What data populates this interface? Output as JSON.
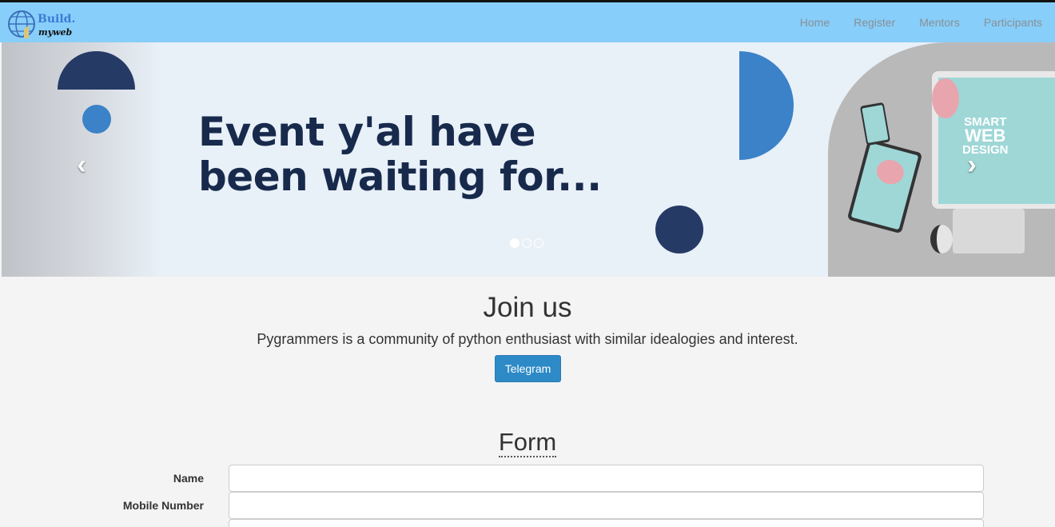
{
  "navbar": {
    "logo_line1": "Build.",
    "logo_line2": "myweb",
    "links": [
      {
        "label": "Home"
      },
      {
        "label": "Register"
      },
      {
        "label": "Mentors"
      },
      {
        "label": "Participants"
      }
    ],
    "bg_color": "#87cefa"
  },
  "carousel": {
    "headline_line1": "Event y'al have",
    "headline_line2": "been waiting for...",
    "prev_icon": "chevron-left-icon",
    "next_icon": "chevron-right-icon",
    "device_text_line1": "SMART",
    "device_text_line2": "WEB",
    "device_text_line3": "DESIGN",
    "slide_count": 3,
    "active_slide": 1
  },
  "join": {
    "title": "Join us",
    "description": "Pygrammers is a community of python enthusiast with similar idealogies and interest.",
    "button_label": "Telegram",
    "button_color": "#2d8ac7"
  },
  "form": {
    "title": "Form",
    "fields": [
      {
        "label": "Name",
        "value": ""
      },
      {
        "label": "Mobile Number",
        "value": ""
      }
    ]
  }
}
